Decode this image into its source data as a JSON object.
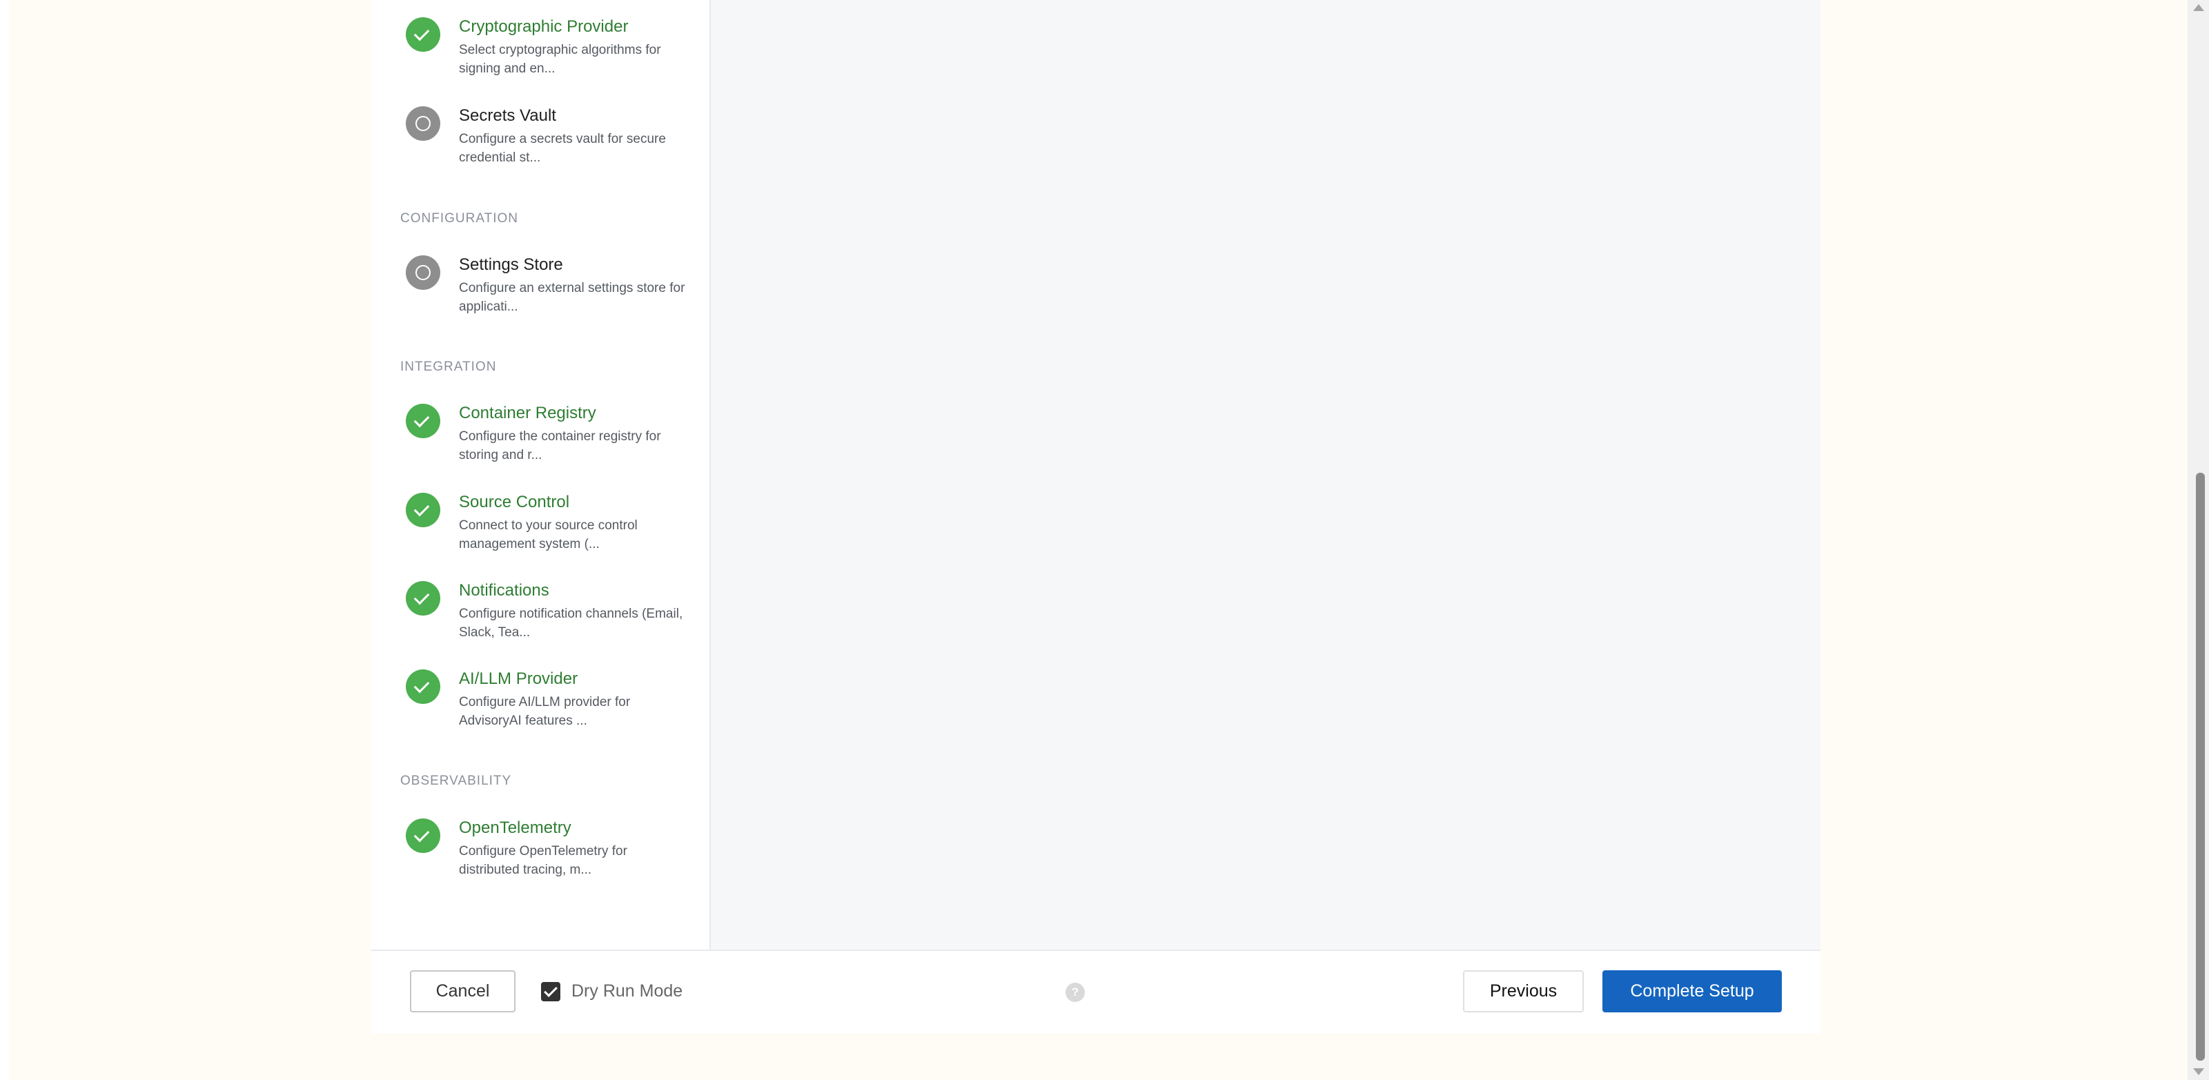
{
  "sidebar": {
    "sections": [
      {
        "label": "CONFIGURATION"
      },
      {
        "label": "INTEGRATION"
      },
      {
        "label": "OBSERVABILITY"
      }
    ],
    "steps": [
      {
        "title": "Cryptographic Provider",
        "desc": "Select cryptographic algorithms for signing and en...",
        "status": "done"
      },
      {
        "title": "Secrets Vault",
        "desc": "Configure a secrets vault for secure credential st...",
        "status": "pending"
      },
      {
        "title": "Settings Store",
        "desc": "Configure an external settings store for applicati...",
        "status": "pending"
      },
      {
        "title": "Container Registry",
        "desc": "Configure the container registry for storing and r...",
        "status": "done"
      },
      {
        "title": "Source Control",
        "desc": "Connect to your source control management system (...",
        "status": "done"
      },
      {
        "title": "Notifications",
        "desc": "Configure notification channels (Email, Slack, Tea...",
        "status": "done"
      },
      {
        "title": "AI/LLM Provider",
        "desc": "Configure AI/LLM provider for AdvisoryAI features ...",
        "status": "done"
      },
      {
        "title": "OpenTelemetry",
        "desc": "Configure OpenTelemetry for distributed tracing, m...",
        "status": "done"
      }
    ]
  },
  "footer": {
    "cancel_label": "Cancel",
    "dry_run_label": "Dry Run Mode",
    "dry_run_checked": true,
    "help_glyph": "?",
    "previous_label": "Previous",
    "complete_label": "Complete Setup"
  },
  "colors": {
    "done": "#4caf50",
    "done_text": "#2e7d32",
    "pending": "#8e8e8e",
    "primary": "#1565c0"
  },
  "icons": {
    "done": "check-circle-icon",
    "pending": "circle-outline-icon",
    "help": "question-mark-icon"
  }
}
